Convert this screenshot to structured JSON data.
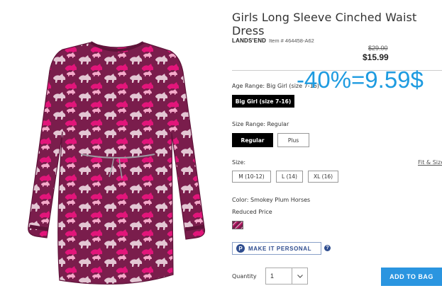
{
  "product": {
    "title": "Girls Long Sleeve Cinched Waist Dress",
    "brand": "LANDS'END",
    "item_number": "Item # 464458-A62",
    "price_old": "$29.00",
    "price_new": "$15.99",
    "image_icon": "dress-photo-icon"
  },
  "overlay": {
    "text": "-40%=9.59$",
    "color": "#1e9be0"
  },
  "age_range": {
    "label": "Age Range: Big Girl (size 7-16)",
    "options": [
      {
        "label": "Big Girl (size 7-16)",
        "selected": true
      }
    ]
  },
  "size_range": {
    "label": "Size Range: Regular",
    "options": [
      {
        "label": "Regular",
        "selected": true
      },
      {
        "label": "Plus",
        "selected": false
      }
    ]
  },
  "size": {
    "label": "Size:",
    "fit_link": "Fit & Size",
    "options": [
      {
        "label": "M (10-12)"
      },
      {
        "label": "L (14)"
      },
      {
        "label": "XL (16)"
      }
    ]
  },
  "color": {
    "label": "Color: Smokey Plum Horses",
    "note": "Reduced Price",
    "swatch_color": "#7a1d4c"
  },
  "personalize": {
    "badge": "P",
    "label": "MAKE IT PERSONAL",
    "help": "?"
  },
  "quantity": {
    "label": "Quantity",
    "value": "1"
  },
  "cart": {
    "button_label": "ADD TO BAG",
    "button_color": "#2a95e0"
  }
}
